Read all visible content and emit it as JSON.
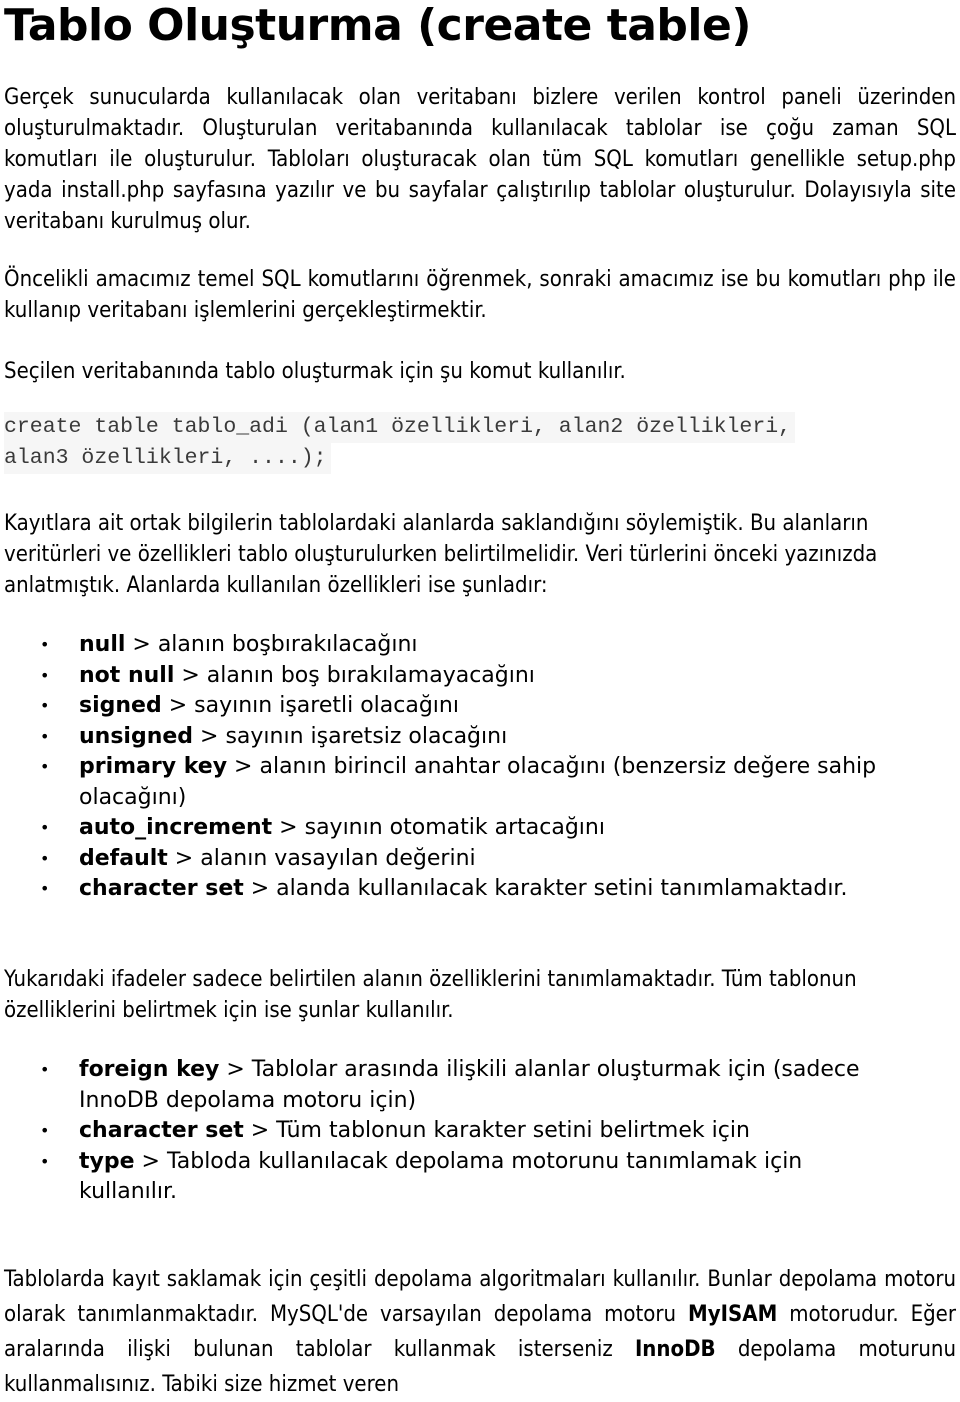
{
  "page": {
    "title": "Tablo Oluşturma (create table)"
  },
  "paragraphs": {
    "intro": "Gerçek sunucularda kullanılacak olan veritabanı bizlere verilen kontrol paneli üzerinden oluşturulmaktadır. Oluşturulan veritabanında kullanılacak tablolar ise çoğu zaman SQL komutları ile oluşturulur. Tabloları oluşturacak olan tüm SQL komutları genellikle setup.php yada install.php sayfasına yazılır ve bu sayfalar çalıştırılıp tablolar oluşturulur. Dolayısıyla site veritabanı kurulmuş olur.",
    "goal": "Öncelikli amacımız temel SQL komutlarını öğrenmek, sonraki amacımız ise bu komutları php ile kullanıp veritabanı işlemlerini gerçekleştirmektir.",
    "command_intro": "Seçilen veritabanında tablo oluşturmak için şu komut kullanılır.",
    "fields_intro": "Kayıtlara ait ortak bilgilerin tablolardaki alanlarda saklandığını söylemiştik. Bu alanların veritürleri ve özellikleri tablo oluşturulurken belirtilmelidir. Veri türlerini önceki yazınızda anlatmıştık. Alanlarda kullanılan özellikleri ise şunladır:",
    "table_props_intro": "Yukarıdaki ifadeler sadece belirtilen alanın özelliklerini tanımlamaktadır. Tüm tablonun özelliklerini belirtmek için ise şunlar kullanılır.",
    "engines_part1": "Tablolarda kayıt saklamak için çeşitli depolama algoritmaları kullanılır. Bunlar depolama motoru olarak tanımlanmaktadır. MySQL'de varsayılan depolama motoru ",
    "engines_myisam": "MyISAM",
    "engines_part2": " motorudur. Eğer aralarında ilişki bulunan tablolar kullanmak isterseniz ",
    "engines_innodb": "InnoDB",
    "engines_part3": " depolama moturunu kullanmalısınız. Tabiki size hizmet veren"
  },
  "code": {
    "line1": "create table tablo_adi (alan1 özellikleri, alan2 özellikleri,",
    "line2": "alan3 özellikleri, ....);"
  },
  "field_properties": [
    {
      "keyword": "null",
      "description": " > alanın boşbırakılacağını"
    },
    {
      "keyword": "not null",
      "description": " > alanın boş bırakılamayacağını"
    },
    {
      "keyword": "signed",
      "description": " > sayının işaretli olacağını"
    },
    {
      "keyword": "unsigned",
      "description": " > sayının işaretsiz olacağını"
    },
    {
      "keyword": "primary key",
      "description": " > alanın birincil anahtar olacağını (benzersiz değere sahip olacağını)"
    },
    {
      "keyword": "auto_increment",
      "description": " > sayının otomatik artacağını"
    },
    {
      "keyword": "default",
      "description": " > alanın vasayılan değerini"
    },
    {
      "keyword": "character set",
      "description": " > alanda kullanılacak karakter setini tanımlamaktadır."
    }
  ],
  "table_properties": [
    {
      "keyword": "foreign key",
      "description": " > Tablolar arasında ilişkili alanlar oluşturmak için (sadece InnoDB depolama motoru için)"
    },
    {
      "keyword": "character set",
      "description": " > Tüm tablonun karakter setini belirtmek için"
    },
    {
      "keyword": "type",
      "description": " > Tabloda kullanılacak depolama motorunu tanımlamak için kullanılır."
    }
  ],
  "bullet_glyph": "•"
}
